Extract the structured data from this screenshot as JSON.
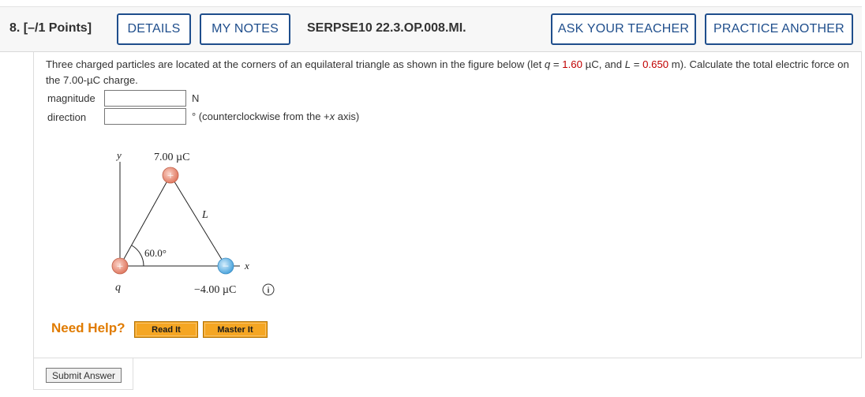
{
  "header": {
    "question_number": "8.  [–/1 Points]",
    "details_label": "DETAILS",
    "my_notes_label": "MY NOTES",
    "reference": "SERPSE10 22.3.OP.008.MI.",
    "ask_teacher_label": "ASK YOUR TEACHER",
    "practice_another_label": "PRACTICE ANOTHER"
  },
  "question": {
    "text_1": "Three charged particles are located at the corners of an equilateral triangle as shown in the figure below (let ",
    "q_var": "q",
    "text_2": " = ",
    "q_value": "1.60",
    "text_3": " µC, and ",
    "L_var": "L",
    "text_4": " = ",
    "L_value": "0.650",
    "text_5": " m). Calculate the total electric force on the 7.00-µC charge."
  },
  "answers": {
    "magnitude_label": "magnitude",
    "magnitude_value": "",
    "magnitude_unit": "N",
    "direction_label": "direction",
    "direction_value": "",
    "direction_unit_1": "° (counterclockwise from the +",
    "direction_unit_x": "x",
    "direction_unit_2": " axis)"
  },
  "figure": {
    "y_axis_label": "y",
    "x_axis_label": "x",
    "top_charge_label": "7.00 µC",
    "side_label": "L",
    "angle_label": "60.0°",
    "left_charge_label": "q",
    "right_charge_label": "−4.00 µC",
    "top_charge_sign": "+",
    "left_charge_sign": "+",
    "right_charge_sign": "−",
    "info_icon_glyph": "i"
  },
  "help": {
    "label": "Need Help?",
    "read_it": "Read It",
    "master_it": "Master It"
  },
  "submit_label": "Submit Answer",
  "colors": {
    "button_border": "#1f4e8c",
    "value_red": "#c00000",
    "help_orange": "#e07b00",
    "help_button": "#f5a623",
    "positive_charge": "#e8826f",
    "negative_charge": "#6cb6e6"
  }
}
